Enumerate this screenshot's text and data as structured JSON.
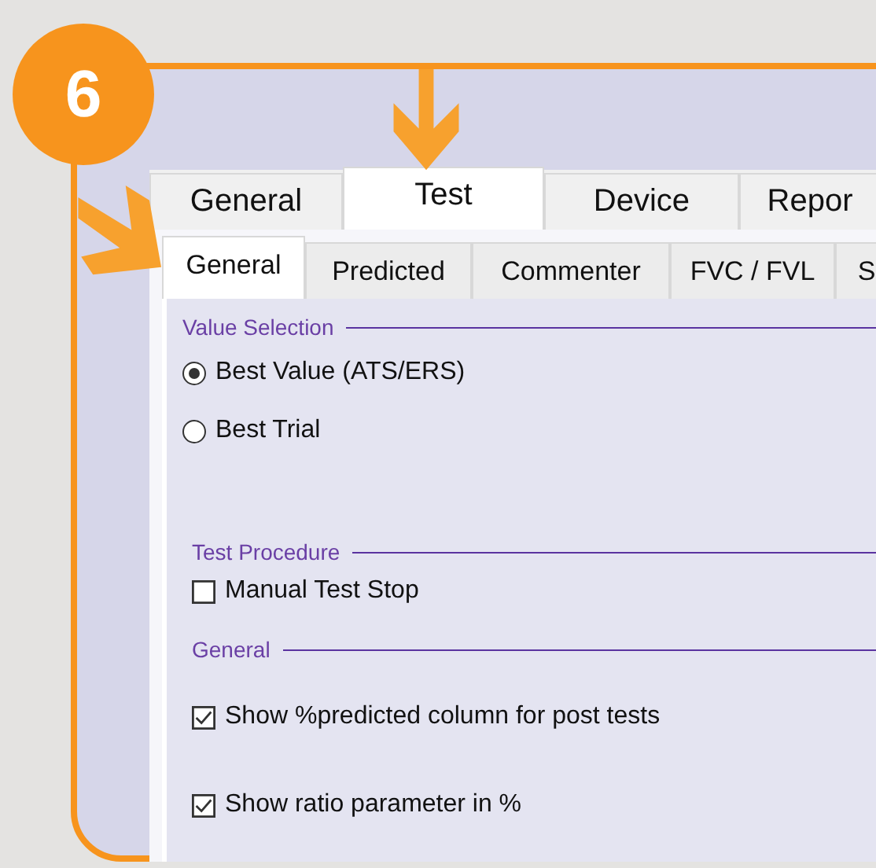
{
  "badge": "6",
  "tabs": [
    {
      "label": "General",
      "selected": false
    },
    {
      "label": "Test",
      "selected": true
    },
    {
      "label": "Device",
      "selected": false
    },
    {
      "label": "Repor",
      "selected": false
    }
  ],
  "subtabs": [
    {
      "label": "General",
      "selected": true
    },
    {
      "label": "Predicted",
      "selected": false
    },
    {
      "label": "Commenter",
      "selected": false
    },
    {
      "label": "FVC / FVL",
      "selected": false
    },
    {
      "label": "S",
      "selected": false
    }
  ],
  "sections": [
    {
      "title": "Value Selection",
      "items": [
        {
          "kind": "radio",
          "label": "Best Value (ATS/ERS)",
          "selected": true
        },
        {
          "kind": "radio",
          "label": "Best Trial",
          "selected": false
        }
      ]
    },
    {
      "title": "Test Procedure",
      "items": [
        {
          "kind": "checkbox",
          "label": "Manual Test Stop",
          "checked": false
        }
      ]
    },
    {
      "title": "General",
      "items": [
        {
          "kind": "checkbox",
          "label": "Show %predicted column for post tests",
          "checked": true
        },
        {
          "kind": "checkbox",
          "label": "Show ratio parameter in %",
          "checked": true
        }
      ]
    }
  ]
}
